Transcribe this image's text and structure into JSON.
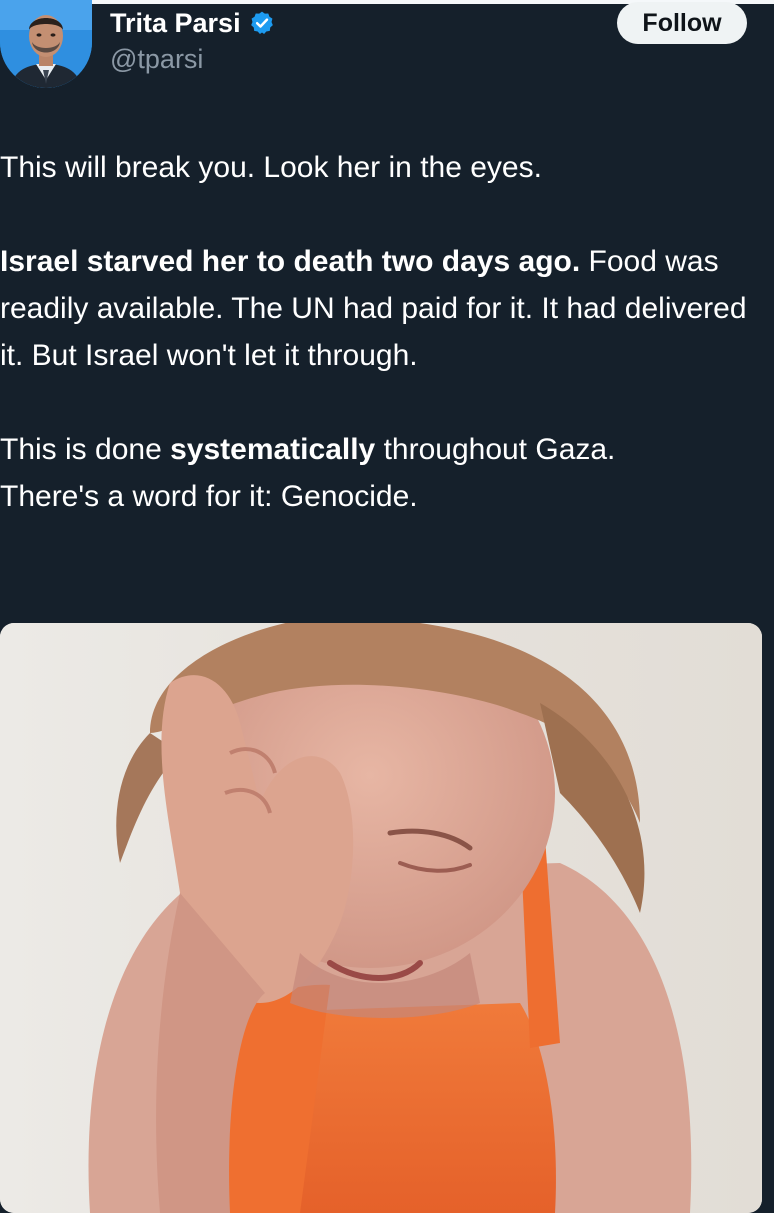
{
  "author": {
    "name": "Trita Parsi",
    "handle": "@tparsi",
    "verified": true,
    "avatar_icon": "avatar-photo"
  },
  "follow_button": {
    "label": "Follow"
  },
  "tweet": {
    "line1": "This will break you. Look her in the eyes.",
    "para2_bold": "Israel starved her to death two days ago.",
    "para2_rest": "Food was readily available. The UN had paid for it. It had delivered it. But Israel won't let it through.",
    "para3_before": "This is done ",
    "para3_bold": "systematically",
    "para3_after": " throughout Gaza.",
    "para3_line2": "There's a word for it: Genocide."
  },
  "media": {
    "kind": "photo"
  },
  "colors": {
    "background": "#15202b",
    "text": "#ffffff",
    "secondary_text": "#8b98a5",
    "verified_blue": "#1d9bf0",
    "follow_bg": "#eff3f4",
    "follow_text": "#0f1419"
  }
}
